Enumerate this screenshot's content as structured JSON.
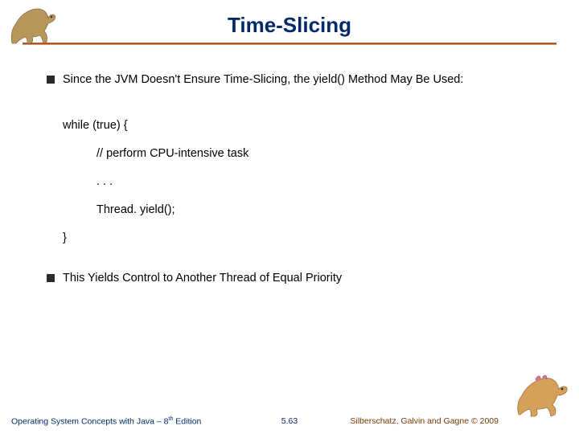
{
  "title": "Time-Slicing",
  "bullets": {
    "b1": "Since the JVM Doesn't Ensure Time-Slicing, the yield() Method May Be Used:",
    "b2": "This Yields Control to Another Thread of Equal Priority"
  },
  "code": {
    "line1": "while (true) {",
    "line2": "// perform CPU-intensive task",
    "line3": ". . .",
    "line4": "Thread. yield();",
    "line5": "}"
  },
  "footer": {
    "left_a": "Operating System Concepts with Java – 8",
    "left_b": " Edition",
    "left_sup": "th",
    "center": "5.63",
    "right": "Silberschatz, Galvin and Gagne © 2009"
  }
}
